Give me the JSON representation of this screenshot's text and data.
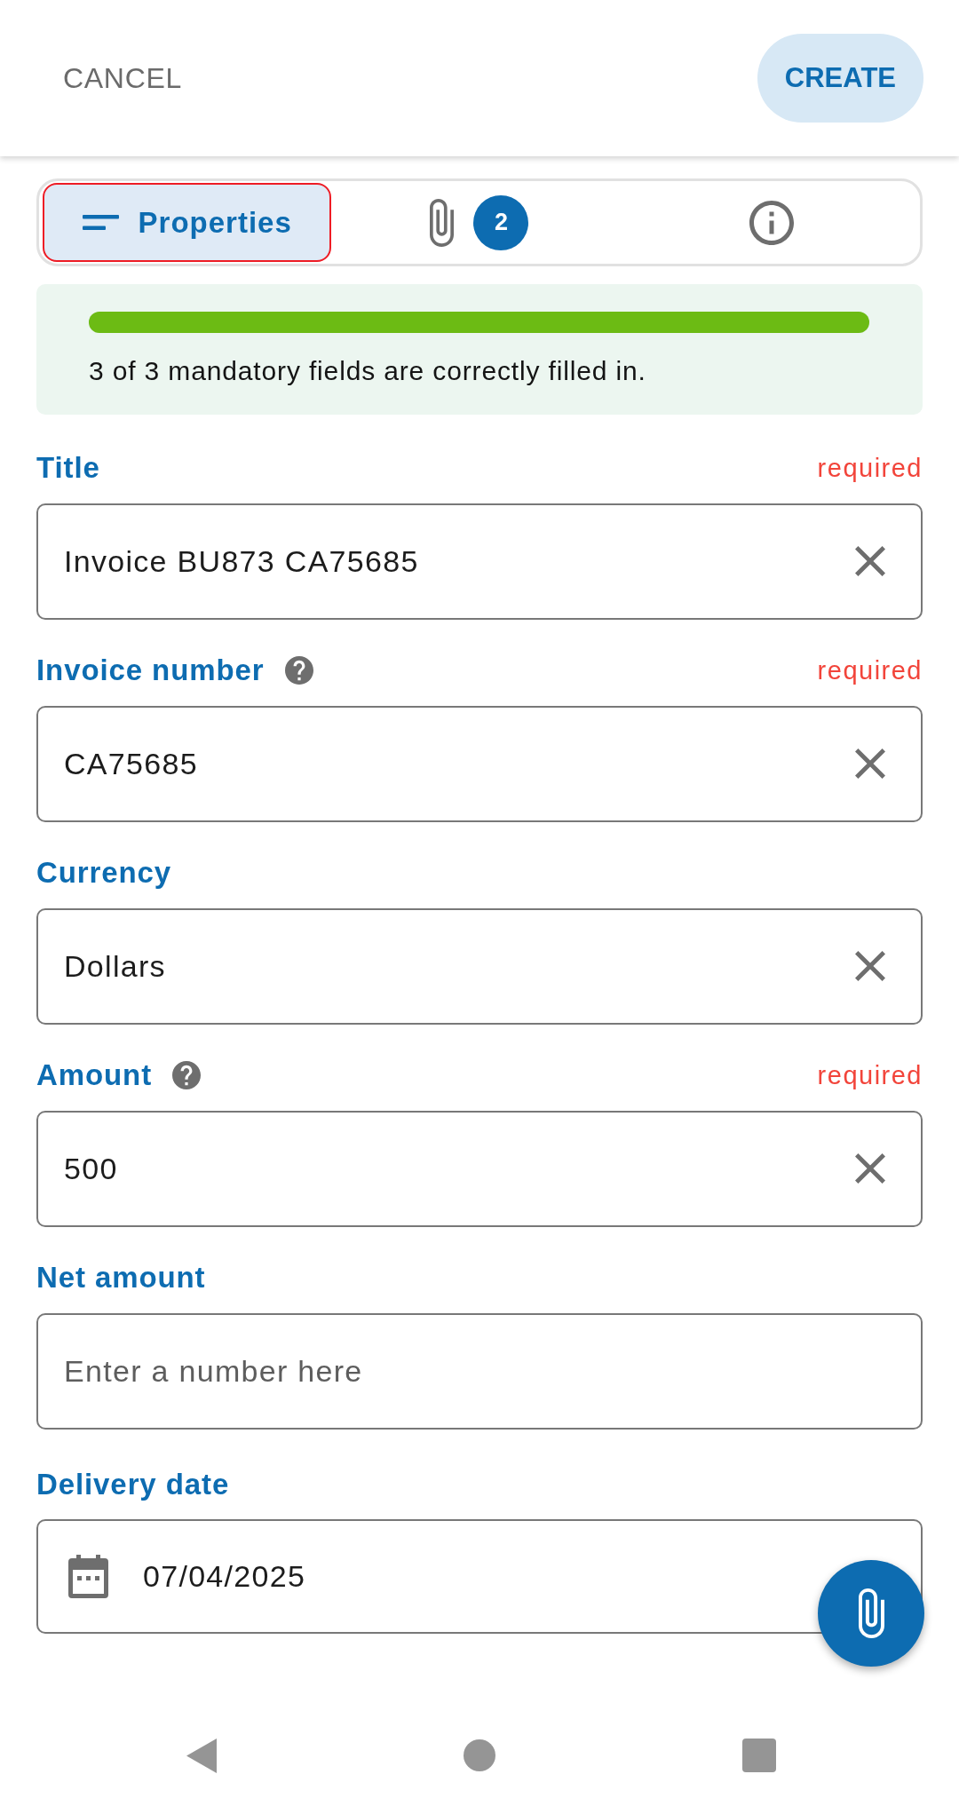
{
  "header": {
    "cancel": "CANCEL",
    "create": "CREATE"
  },
  "tabs": [
    {
      "kind": "properties",
      "label": "Properties",
      "selected": true,
      "focused": true
    },
    {
      "kind": "attachments",
      "badge": "2",
      "selected": false,
      "focused": false
    },
    {
      "kind": "info",
      "selected": false,
      "focused": false
    }
  ],
  "progress": {
    "level": 1,
    "message": "3 of 3 mandatory fields are correctly filled in."
  },
  "fields": [
    {
      "kind": "text",
      "label": "Title",
      "help": false,
      "required_note": "required",
      "value": "Invoice BU873 CA75685",
      "clearable": true
    },
    {
      "kind": "text",
      "label": "Invoice number",
      "help": true,
      "required_note": "required",
      "value": "CA75685",
      "clearable": true
    },
    {
      "kind": "text",
      "label": "Currency",
      "help": false,
      "value": "Dollars",
      "clearable": true
    },
    {
      "kind": "text",
      "label": "Amount",
      "help": true,
      "required_note": "required",
      "value": "500",
      "clearable": true
    },
    {
      "kind": "text",
      "label": "Net amount",
      "help": false,
      "placeholder": "Enter a number here",
      "clearable": false
    },
    {
      "kind": "date",
      "label": "Delivery date",
      "help": false,
      "value": "07/04/2025",
      "clearable": false
    }
  ]
}
